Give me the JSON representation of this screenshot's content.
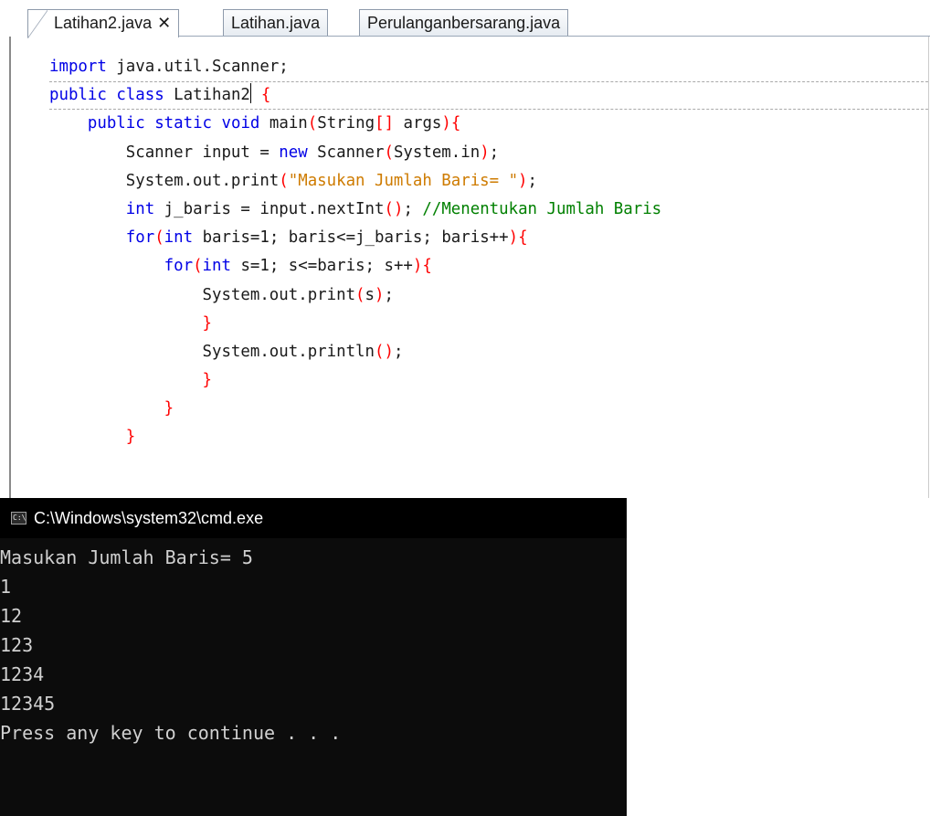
{
  "tabs": [
    {
      "label": "Latihan2.java",
      "active": true,
      "close": "✕"
    },
    {
      "label": "Latihan.java",
      "active": false
    },
    {
      "label": "Perulanganbersarang.java",
      "active": false
    }
  ],
  "code": {
    "lines": [
      "import java.util.Scanner;",
      "public class Latihan2 {",
      "    public static void main(String[] args){",
      "        Scanner input = new Scanner(System.in);",
      "        System.out.print(\"Masukan Jumlah Baris= \");",
      "        int j_baris = input.nextInt(); //Menentukan Jumlah Baris",
      "        for(int baris=1; baris<=j_baris; baris++){",
      "            for(int s=1; s<=baris; s++){",
      "                System.out.print(s);",
      "                }",
      "                System.out.println();",
      "                }",
      "            }",
      "        }"
    ]
  },
  "console": {
    "title": "C:\\Windows\\system32\\cmd.exe",
    "icon_text": "C:\\",
    "icon": "cmd-icon",
    "output_lines": [
      "Masukan Jumlah Baris= 5",
      "1",
      "12",
      "123",
      "1234",
      "12345",
      "Press any key to continue . . ."
    ]
  },
  "colors": {
    "keyword": "#0000e6",
    "string": "#ce7b00",
    "comment": "#008000",
    "bracket": "#ff0000",
    "console_bg": "#0c0c0c",
    "console_text": "#d0d0d0"
  }
}
